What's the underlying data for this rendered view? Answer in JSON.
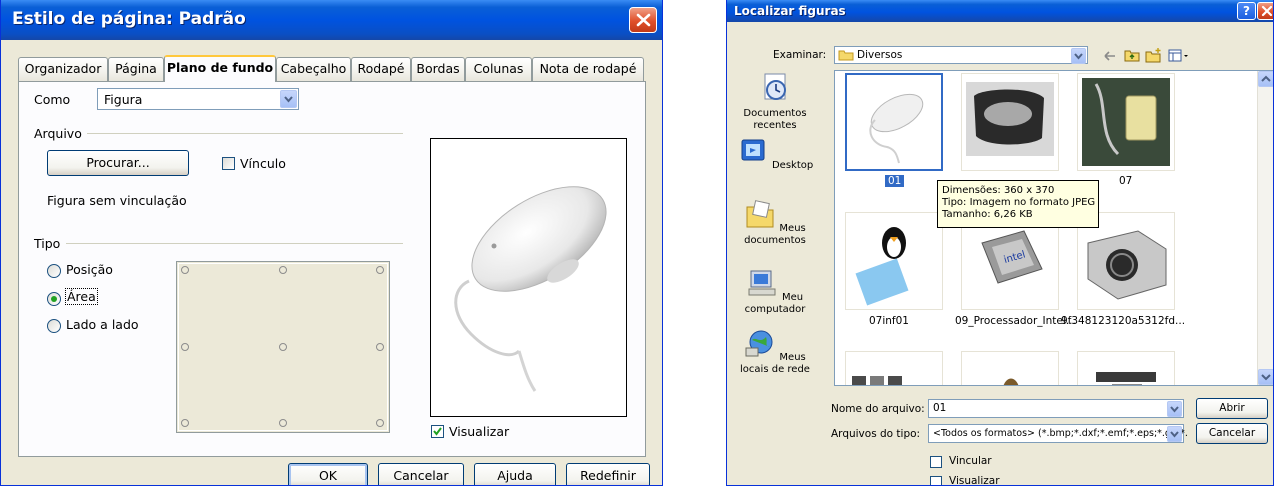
{
  "left_dialog": {
    "title": "Estilo de página: Padrão",
    "tabs": [
      "Organizador",
      "Página",
      "Plano de fundo",
      "Cabeçalho",
      "Rodapé",
      "Bordas",
      "Colunas",
      "Nota de rodapé"
    ],
    "active_tab": "Plano de fundo",
    "como_label": "Como",
    "como_value": "Figura",
    "arquivo_label": "Arquivo",
    "procurar_button": "Procurar...",
    "vinculo_label": "Vínculo",
    "vinculo_checked": false,
    "figura_status": "Figura sem vinculação",
    "tipo_label": "Tipo",
    "tipo_options": [
      "Posição",
      "Área",
      "Lado a lado"
    ],
    "tipo_selected": "Área",
    "visualizar_label": "Visualizar",
    "visualizar_checked": true,
    "buttons": {
      "ok": "OK",
      "cancel": "Cancelar",
      "help": "Ajuda",
      "reset": "Redefinir"
    }
  },
  "right_dialog": {
    "title": "Localizar figuras",
    "title_help": "?",
    "examinar_label": "Examinar:",
    "examinar_value": "Diversos",
    "places": [
      "Documentos recentes",
      "Desktop",
      "Meus documentos",
      "Meu computador",
      "Meus locais de rede"
    ],
    "files": [
      {
        "name": "01",
        "selected": true
      },
      {
        "name": "",
        "selected": false
      },
      {
        "name": "07",
        "selected": false
      },
      {
        "name": "07inf01",
        "selected": false
      },
      {
        "name": "09_Processador_Intel...",
        "selected": false
      },
      {
        "name": "9f348123120a5312fd...",
        "selected": false
      }
    ],
    "tooltip": {
      "dim": "Dimensões: 360 x 370",
      "type": "Tipo: Imagem no formato JPEG",
      "size": "Tamanho: 6,26 KB"
    },
    "filename_label": "Nome do arquivo:",
    "filename_value": "01",
    "filetype_label": "Arquivos do tipo:",
    "filetype_value": "<Todos os formatos> (*.bmp;*.dxf;*.emf;*.eps;*.gif;*.",
    "open_button": "Abrir",
    "cancel_button": "Cancelar",
    "vincular_label": "Vincular",
    "visualizar_label": "Visualizar"
  }
}
